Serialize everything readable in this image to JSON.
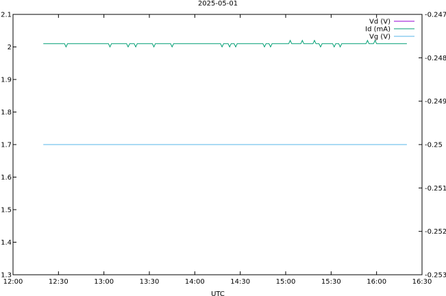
{
  "chart_data": {
    "type": "line",
    "title": "2025-05-01",
    "xlabel": "UTC",
    "ylabel": "",
    "y2label": "",
    "x_unit": "hh:mm",
    "xlim": [
      "12:00",
      "16:30"
    ],
    "ylim": [
      1.3,
      2.1
    ],
    "y2lim": [
      -0.253,
      -0.247
    ],
    "x_ticks": [
      "12:00",
      "12:30",
      "13:00",
      "13:30",
      "14:00",
      "14:30",
      "15:00",
      "15:30",
      "16:00",
      "16:30"
    ],
    "y_ticks": [
      "1.3",
      "1.4",
      "1.5",
      "1.6",
      "1.7",
      "1.8",
      "1.9",
      "2",
      "2.1"
    ],
    "y2_ticks": [
      "-0.253",
      "-0.252",
      "-0.251",
      "-0.25",
      "-0.249",
      "-0.248",
      "-0.247"
    ],
    "grid": false,
    "legend_position": "top-right",
    "series": [
      {
        "name": "Vd (V)",
        "axis": "y1",
        "color": "#9400d3",
        "x": [],
        "y": []
      },
      {
        "name": "Id (mA)",
        "axis": "y1",
        "color": "#009e73",
        "x": [
          "12:20",
          "12:34",
          "12:35",
          "12:36",
          "13:03",
          "13:04",
          "13:05",
          "13:15",
          "13:16",
          "13:17",
          "13:20",
          "13:21",
          "13:22",
          "13:32",
          "13:33",
          "13:34",
          "13:44",
          "13:45",
          "13:46",
          "14:17",
          "14:18",
          "14:19",
          "14:22",
          "14:23",
          "14:24",
          "14:26",
          "14:27",
          "14:28",
          "14:45",
          "14:46",
          "14:47",
          "14:49",
          "14:50",
          "14:51",
          "15:02",
          "15:03",
          "15:04",
          "15:10",
          "15:11",
          "15:12",
          "15:18",
          "15:19",
          "15:20",
          "15:22",
          "15:23",
          "15:24",
          "15:31",
          "15:32",
          "15:33",
          "15:35",
          "15:36",
          "15:37",
          "15:53",
          "15:54",
          "15:55",
          "15:58",
          "15:59",
          "16:00",
          "16:20"
        ],
        "y": [
          2.01,
          2.01,
          2.0,
          2.01,
          2.01,
          2.0,
          2.01,
          2.01,
          2.0,
          2.01,
          2.01,
          2.0,
          2.01,
          2.01,
          2.0,
          2.01,
          2.01,
          2.0,
          2.01,
          2.01,
          2.0,
          2.01,
          2.01,
          2.0,
          2.01,
          2.01,
          2.0,
          2.01,
          2.01,
          2.0,
          2.01,
          2.01,
          2.0,
          2.01,
          2.01,
          2.02,
          2.01,
          2.01,
          2.02,
          2.01,
          2.01,
          2.02,
          2.01,
          2.01,
          2.0,
          2.01,
          2.01,
          2.0,
          2.01,
          2.01,
          2.0,
          2.01,
          2.01,
          2.02,
          2.01,
          2.01,
          2.02,
          2.01,
          2.01
        ]
      },
      {
        "name": "Vg (V)",
        "axis": "y2",
        "color": "#56b4e9",
        "x": [
          "12:20",
          "16:20"
        ],
        "y": [
          -0.25,
          -0.25
        ]
      }
    ]
  }
}
